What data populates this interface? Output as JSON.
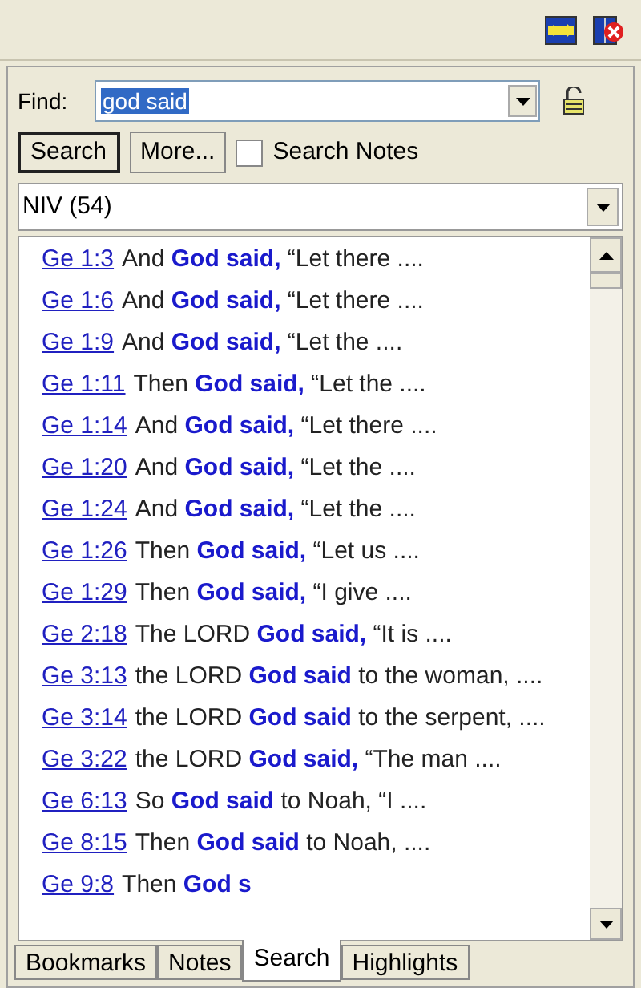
{
  "find": {
    "label": "Find:",
    "value": "god said"
  },
  "buttons": [
    "Search",
    "More..."
  ],
  "search_notes": {
    "label": "Search Notes",
    "checked": false
  },
  "version": {
    "value": "NIV (54)"
  },
  "results": [
    {
      "ref": "Ge 1:3",
      "text": "And **God said,** “Let there ...."
    },
    {
      "ref": "Ge 1:6",
      "text": "And **God said,** “Let there ...."
    },
    {
      "ref": "Ge 1:9",
      "text": "And **God said,** “Let the ...."
    },
    {
      "ref": "Ge 1:11",
      "text": "Then **God said,** “Let the ...."
    },
    {
      "ref": "Ge 1:14",
      "text": "And **God said,** “Let there ...."
    },
    {
      "ref": "Ge 1:20",
      "text": "And **God said,** “Let the ...."
    },
    {
      "ref": "Ge 1:24",
      "text": "And **God said,** “Let the ...."
    },
    {
      "ref": "Ge 1:26",
      "text": "Then **God said,** “Let us ...."
    },
    {
      "ref": "Ge 1:29",
      "text": "Then **God said,** “I give ...."
    },
    {
      "ref": "Ge 2:18",
      "text": "The LORD **God said,** “It is ...."
    },
    {
      "ref": "Ge 3:13",
      "text": "the LORD **God said** to the woman, ...."
    },
    {
      "ref": "Ge 3:14",
      "text": "the LORD **God said** to the serpent, ...."
    },
    {
      "ref": "Ge 3:22",
      "text": "the LORD **God said,** “The man ...."
    },
    {
      "ref": "Ge 6:13",
      "text": "So **God said** to Noah, “I ...."
    },
    {
      "ref": "Ge 8:15",
      "text": "Then **God said** to Noah, ...."
    },
    {
      "ref": "Ge 9:8",
      "text": "Then **God s**"
    }
  ],
  "tabs": [
    {
      "label": "Bookmarks",
      "selected": false
    },
    {
      "label": "Notes",
      "selected": false
    },
    {
      "label": "Search",
      "selected": true
    },
    {
      "label": "Highlights",
      "selected": false
    }
  ]
}
